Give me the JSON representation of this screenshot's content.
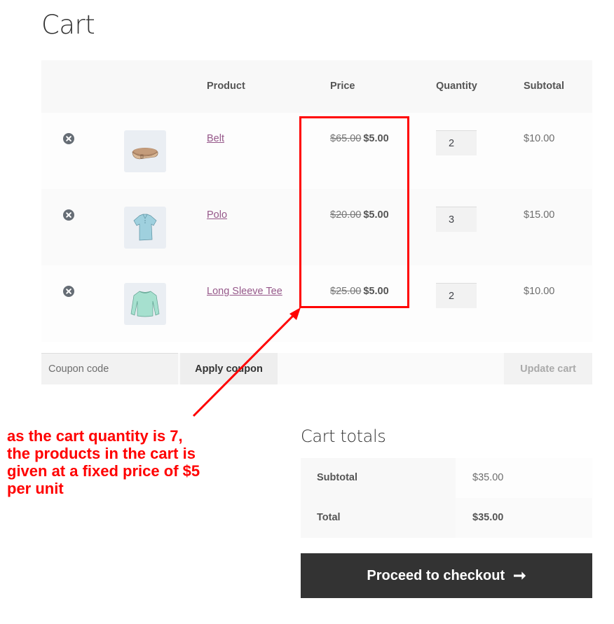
{
  "page": {
    "title": "Cart"
  },
  "table": {
    "headers": {
      "remove": "",
      "thumbnail": "",
      "product": "Product",
      "price": "Price",
      "quantity": "Quantity",
      "subtotal": "Subtotal"
    },
    "rows": [
      {
        "product": "Belt",
        "thumbnail": "belt-image",
        "regular_price": "$65.00",
        "sale_price": "$5.00",
        "quantity": "2",
        "subtotal": "$10.00"
      },
      {
        "product": "Polo",
        "thumbnail": "polo-image",
        "regular_price": "$20.00",
        "sale_price": "$5.00",
        "quantity": "3",
        "subtotal": "$15.00"
      },
      {
        "product": "Long Sleeve Tee",
        "thumbnail": "long-sleeve-tee-image",
        "regular_price": "$25.00",
        "sale_price": "$5.00",
        "quantity": "2",
        "subtotal": "$10.00"
      }
    ]
  },
  "actions": {
    "coupon_placeholder": "Coupon code",
    "coupon_value": "",
    "apply_coupon": "Apply coupon",
    "update_cart": "Update cart"
  },
  "totals": {
    "title": "Cart totals",
    "subtotal_label": "Subtotal",
    "subtotal_value": "$35.00",
    "total_label": "Total",
    "total_value": "$35.00",
    "checkout_label": "Proceed to checkout",
    "checkout_icon": "right-arrow-icon",
    "checkout_arrow": "➞"
  },
  "annotation": {
    "text": "as the cart quantity is 7, the products in the cart is given at a fixed price of $5 per unit",
    "color": "#ff0000"
  },
  "colors": {
    "link": "#96588a",
    "checkout_bg": "#333333",
    "highlight": "#ff0000"
  }
}
